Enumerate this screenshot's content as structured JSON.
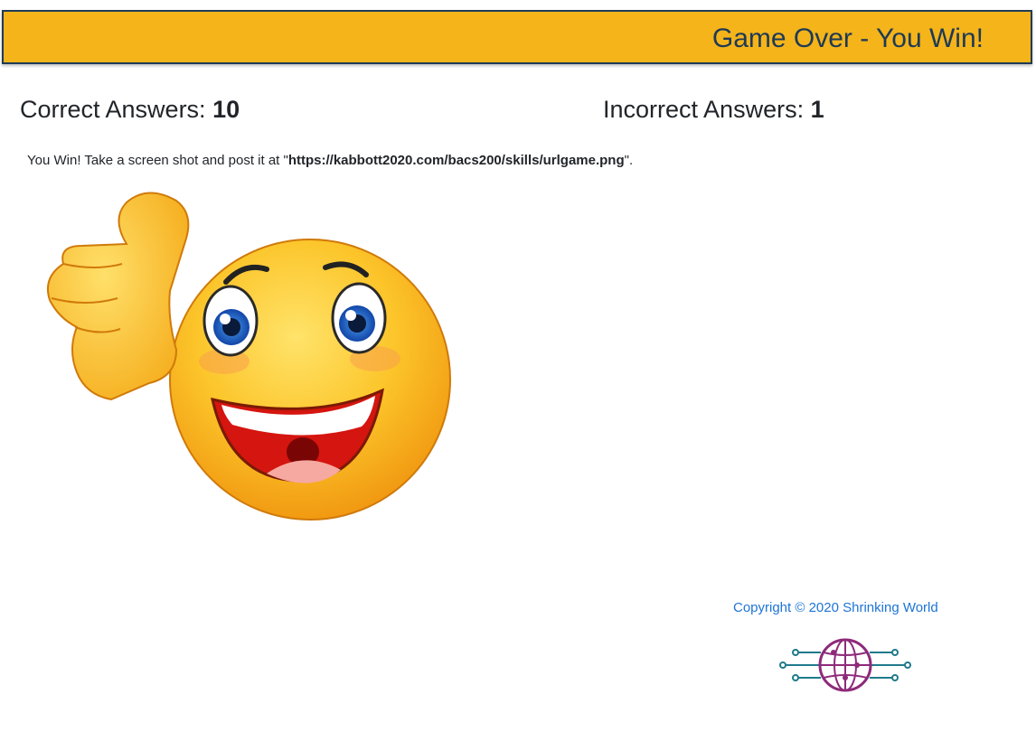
{
  "header": {
    "title": "Game Over - You Win!"
  },
  "scores": {
    "correct_label": "Correct Answers: ",
    "correct_value": "10",
    "incorrect_label": "Incorrect Answers: ",
    "incorrect_value": "1"
  },
  "message": {
    "prefix": "You Win! Take a screen shot and post it at \"",
    "url": "https://kabbott2020.com/bacs200/skills/urlgame.png",
    "suffix": "\"."
  },
  "images": {
    "main": "thumbs-up-smiley-icon",
    "logo": "globe-circuit-logo-icon"
  },
  "footer": {
    "copyright": "Copyright © 2020 Shrinking World"
  },
  "colors": {
    "header_bg": "#f4b41a",
    "header_text": "#1e3a55",
    "link": "#1d74d6",
    "logo_teal": "#1f7a8c",
    "logo_purple": "#8e2a7a"
  }
}
